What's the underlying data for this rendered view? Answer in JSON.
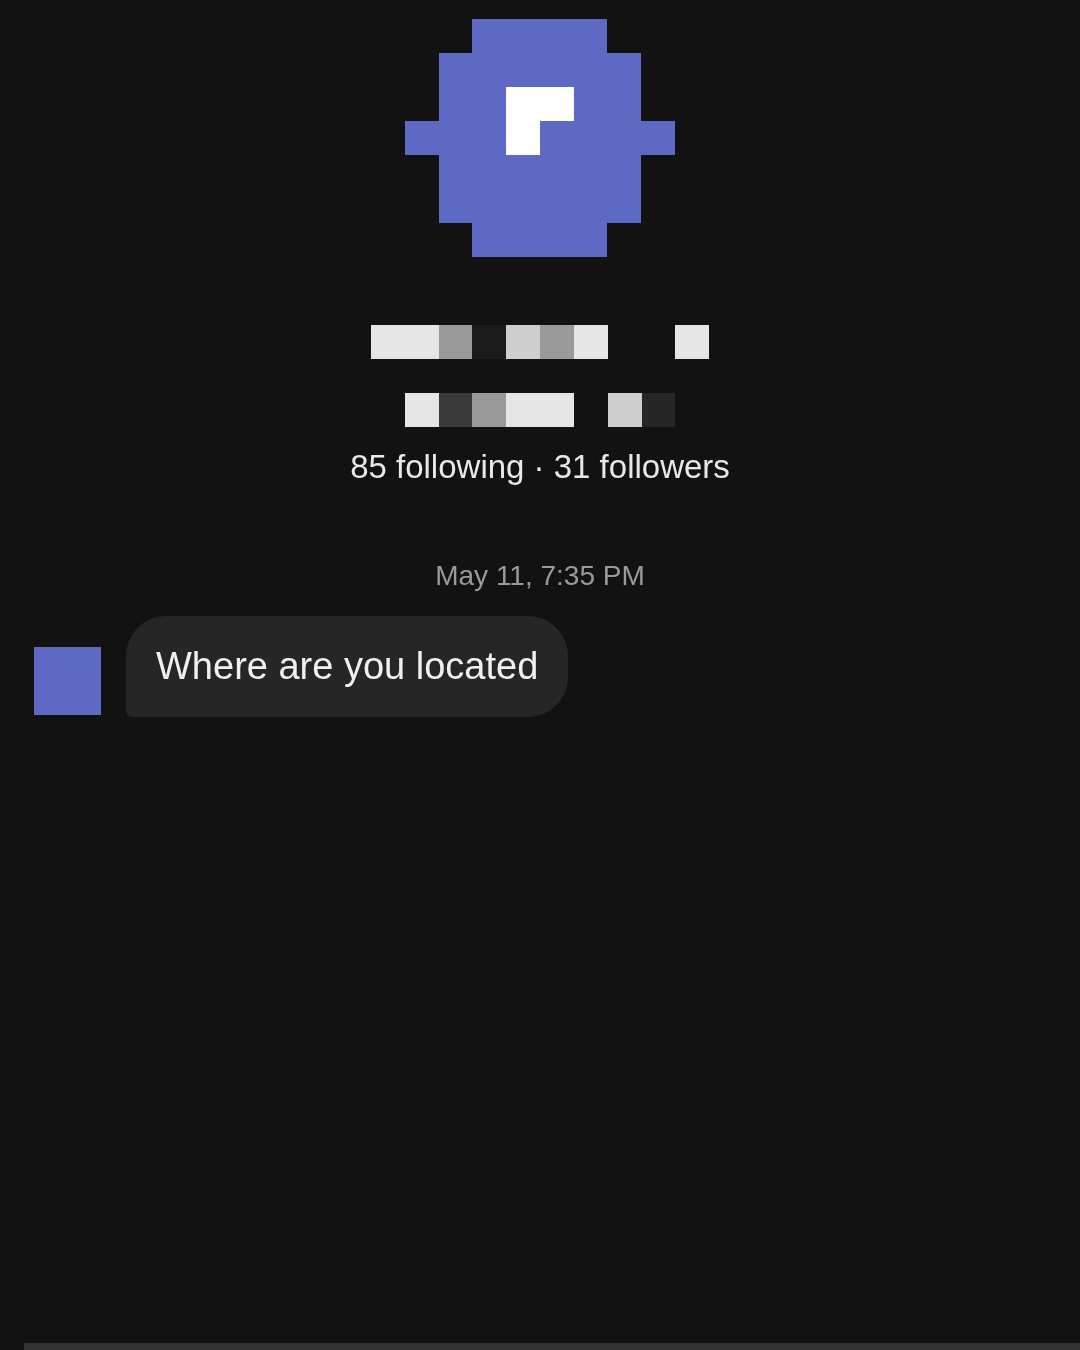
{
  "profile": {
    "stats": "85 following · 31 followers"
  },
  "messages": [
    {
      "timestamp": "May 11, 7:35 PM",
      "text": "Where are you located"
    }
  ]
}
